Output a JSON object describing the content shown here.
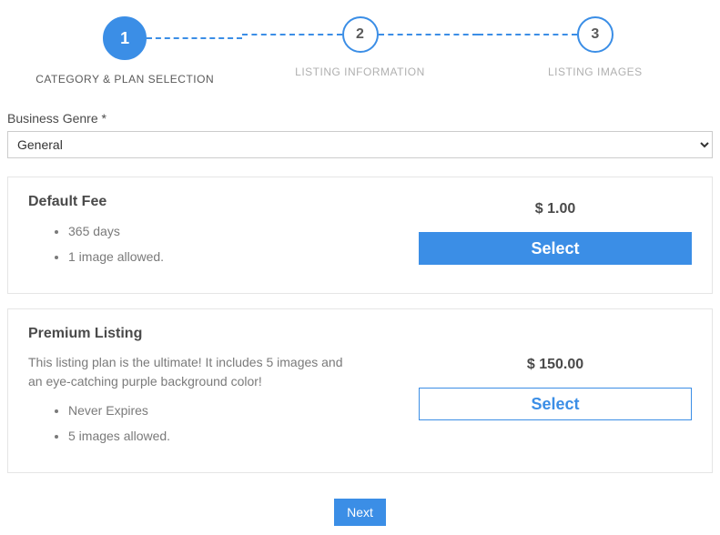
{
  "stepper": {
    "steps": [
      {
        "num": "1",
        "label": "CATEGORY & PLAN SELECTION"
      },
      {
        "num": "2",
        "label": "LISTING INFORMATION"
      },
      {
        "num": "3",
        "label": "LISTING IMAGES"
      }
    ]
  },
  "genre": {
    "label": "Business Genre *",
    "selected": "General"
  },
  "plans": [
    {
      "title": "Default Fee",
      "desc": "",
      "features": [
        "365 days",
        "1 image allowed."
      ],
      "price": "$ 1.00",
      "select_label": "Select",
      "selected": true
    },
    {
      "title": "Premium Listing",
      "desc": "This listing plan is the ultimate! It includes 5 images and an eye-catching purple background color!",
      "features": [
        "Never Expires",
        "5 images allowed."
      ],
      "price": "$ 150.00",
      "select_label": "Select",
      "selected": false
    }
  ],
  "buttons": {
    "next": "Next"
  }
}
